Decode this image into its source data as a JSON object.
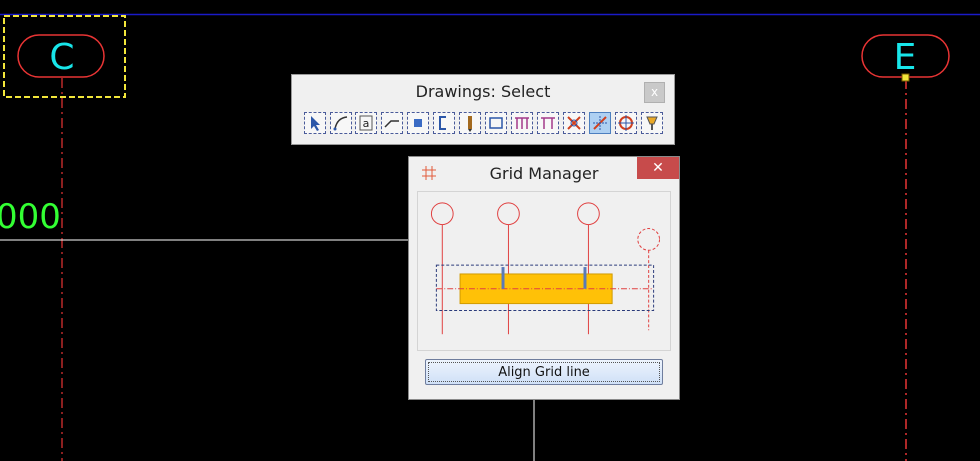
{
  "canvas": {
    "grid_labels": [
      {
        "id": "C",
        "text": "C"
      },
      {
        "id": "E",
        "text": "E"
      }
    ],
    "dimension_text": "000",
    "colors": {
      "background": "#000000",
      "grid_line": "#e83434",
      "bubble_text": "#18e6ea",
      "dimension_text": "#33ff33",
      "selection": "#f2e63a",
      "top_line": "#1a1ac8"
    }
  },
  "toolbar": {
    "title": "Drawings: Select",
    "close_label": "x",
    "buttons": [
      {
        "name": "select-arrow-icon"
      },
      {
        "name": "arc-icon"
      },
      {
        "name": "text-icon",
        "glyph": "a"
      },
      {
        "name": "polyline-icon"
      },
      {
        "name": "point-icon"
      },
      {
        "name": "bracket-icon"
      },
      {
        "name": "pile-icon"
      },
      {
        "name": "rectangle-icon"
      },
      {
        "name": "multi-column-icon"
      },
      {
        "name": "frame-icon"
      },
      {
        "name": "cross-icon"
      },
      {
        "name": "grid-align-icon",
        "active": true
      },
      {
        "name": "target-icon"
      },
      {
        "name": "lamp-icon"
      }
    ]
  },
  "grid_manager": {
    "title": "Grid Manager",
    "close_label": "✕",
    "align_button_label": "Align Grid line"
  }
}
